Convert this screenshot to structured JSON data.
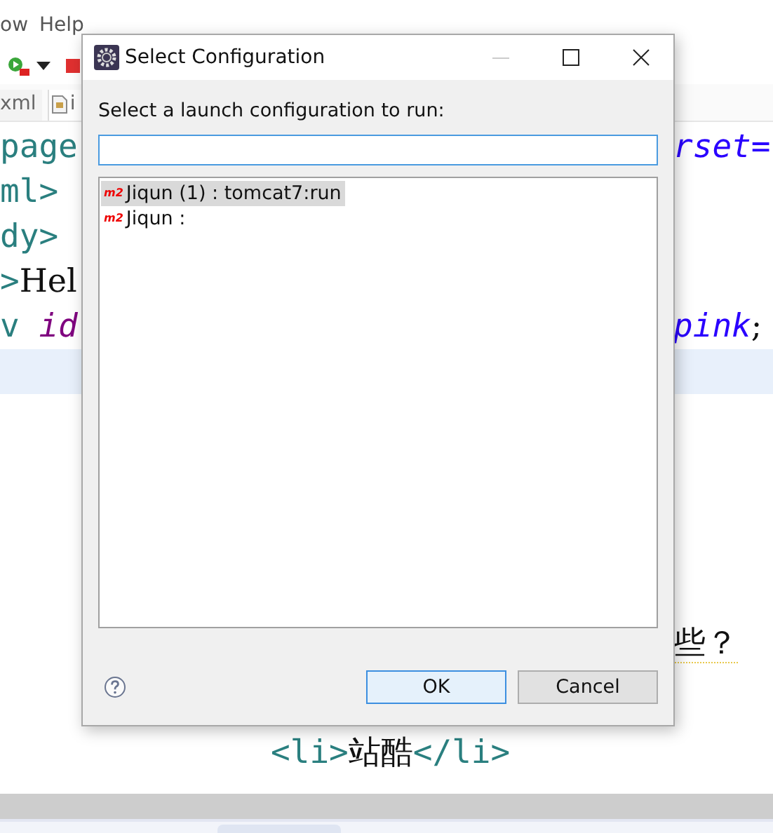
{
  "menu_bar": {
    "items": [
      {
        "label": "ow"
      },
      {
        "label": "Help"
      }
    ]
  },
  "toolbar": {
    "buttons": [
      {
        "kind": "run"
      },
      {
        "kind": "dropdown"
      },
      {
        "kind": "stop"
      }
    ]
  },
  "editor_tabs": [
    {
      "label": "xml",
      "kind": "plain"
    },
    {
      "label": "i",
      "kind": "file"
    }
  ],
  "editor": {
    "lines": [
      {
        "kind": "edge",
        "current": false,
        "left": [
          {
            "kind": "tag",
            "text": "page"
          }
        ],
        "right": [
          {
            "kind": "value",
            "text": "rset="
          }
        ]
      },
      {
        "kind": "edge",
        "current": false,
        "left": [
          {
            "kind": "tag",
            "text": "ml>"
          }
        ]
      },
      {
        "kind": "edge",
        "current": false,
        "left": [
          {
            "kind": "tag",
            "text": "dy>"
          }
        ]
      },
      {
        "kind": "edge",
        "current": false,
        "left": [
          {
            "kind": "tag",
            "text": ">"
          },
          {
            "kind": "text",
            "text": "Hel"
          }
        ]
      },
      {
        "kind": "edge",
        "current": false,
        "left": [
          {
            "kind": "tag",
            "text": "v "
          },
          {
            "kind": "attr",
            "text": "id"
          }
        ],
        "right": [
          {
            "kind": "value",
            "text": "pink"
          },
          {
            "kind": "text",
            "text": ";"
          }
        ]
      },
      {
        "kind": "edge",
        "current": true
      },
      {
        "kind": "note",
        "current": false,
        "right": [
          {
            "kind": "text",
            "text": "些？"
          }
        ]
      },
      {
        "kind": "nested",
        "current": false,
        "left": [
          {
            "kind": "tag",
            "text": "<li>"
          },
          {
            "kind": "text",
            "text": "站酷"
          },
          {
            "kind": "tag",
            "text": "</li>"
          }
        ]
      }
    ]
  },
  "dialog": {
    "title": "Select Configuration",
    "prompt": "Select a launch configuration to run:",
    "items": [
      {
        "badge": "m2",
        "label": "Jiqun (1) : tomcat7:run",
        "selected": true
      },
      {
        "badge": "m2",
        "label": "Jiqun :",
        "selected": false
      }
    ],
    "buttons": [
      {
        "label": "OK",
        "kind": "default"
      },
      {
        "label": "Cancel",
        "kind": "normal"
      }
    ]
  }
}
